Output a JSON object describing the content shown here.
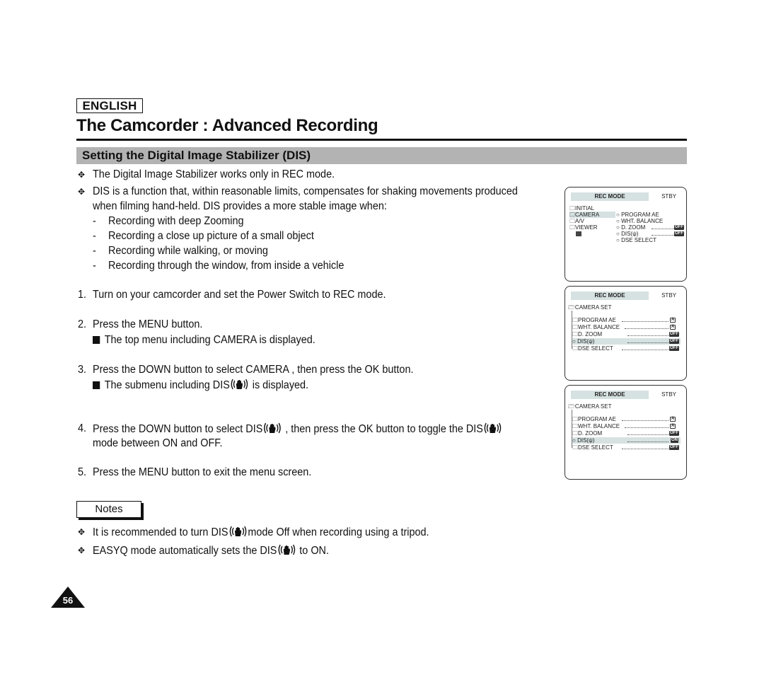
{
  "header": {
    "language": "ENGLISH",
    "title": "The Camcorder : Advanced Recording",
    "section": "Setting the Digital Image Stabilizer (DIS)"
  },
  "intro": {
    "bullets": [
      "The Digital Image Stabilizer works only in REC mode.",
      "DIS is a function that, within reasonable limits, compensates for shaking movements produced",
      "when filming hand-held. DIS provides a more stable image when:"
    ],
    "cases": [
      "Recording with deep Zooming",
      "Recording a close up picture of a small object",
      "Recording while walking, or moving",
      "Recording through the window, from inside a vehicle"
    ]
  },
  "steps": [
    {
      "num": "1.",
      "text": "Turn on your camcorder and set the Power Switch to REC mode."
    },
    {
      "num": "2.",
      "text": "Press the MENU button.",
      "sub": "The top menu including  CAMERA  is displayed."
    },
    {
      "num": "3.",
      "text": "Press the DOWN button to select  CAMERA , then press the OK button.",
      "sub_pre": "The submenu including  DIS",
      "sub_post": "  is displayed."
    },
    {
      "num": "4.",
      "pre": "Press the DOWN button to select  DIS",
      "mid": " , then press the OK button to toggle the DIS",
      "line2": "mode between ON and OFF."
    },
    {
      "num": "5.",
      "text": "Press the MENU button to exit the menu screen."
    }
  ],
  "notes": {
    "label": "Notes",
    "items": [
      {
        "pre": "It is recommended to turn DIS",
        "post": "mode Off when recording using a tripod."
      },
      {
        "pre": "EASYQ mode automatically sets the DIS",
        "post": " to ON."
      }
    ]
  },
  "page_number": "56",
  "osd_screens": [
    {
      "title": "REC MODE",
      "status": "STBY",
      "left_menu": [
        "INITIAL",
        "CAMERA",
        "A/V",
        "VIEWER"
      ],
      "right_menu": [
        {
          "label": "PROGRAM AE",
          "value": ""
        },
        {
          "label": "WHT. BALANCE",
          "value": ""
        },
        {
          "label": "D. ZOOM",
          "value": "OFF"
        },
        {
          "label": "DIS",
          "value": "OFF"
        },
        {
          "label": "DSE SELECT",
          "value": ""
        }
      ]
    },
    {
      "title": "REC MODE",
      "status": "STBY",
      "submenu_title": "CAMERA SET",
      "items": [
        {
          "label": "PROGRAM AE",
          "value": "A"
        },
        {
          "label": "WHT. BALANCE",
          "value": "A"
        },
        {
          "label": "D. ZOOM",
          "value": "OFF"
        },
        {
          "label": "DIS",
          "value": "OFF"
        },
        {
          "label": "DSE SELECT",
          "value": "OFF"
        }
      ]
    },
    {
      "title": "REC MODE",
      "status": "STBY",
      "submenu_title": "CAMERA SET",
      "items": [
        {
          "label": "PROGRAM AE",
          "value": "A"
        },
        {
          "label": "WHT. BALANCE",
          "value": "A"
        },
        {
          "label": "D. ZOOM",
          "value": "OFF"
        },
        {
          "label": "DIS",
          "value": "ON"
        },
        {
          "label": "DSE SELECT",
          "value": "OFF"
        }
      ]
    }
  ]
}
